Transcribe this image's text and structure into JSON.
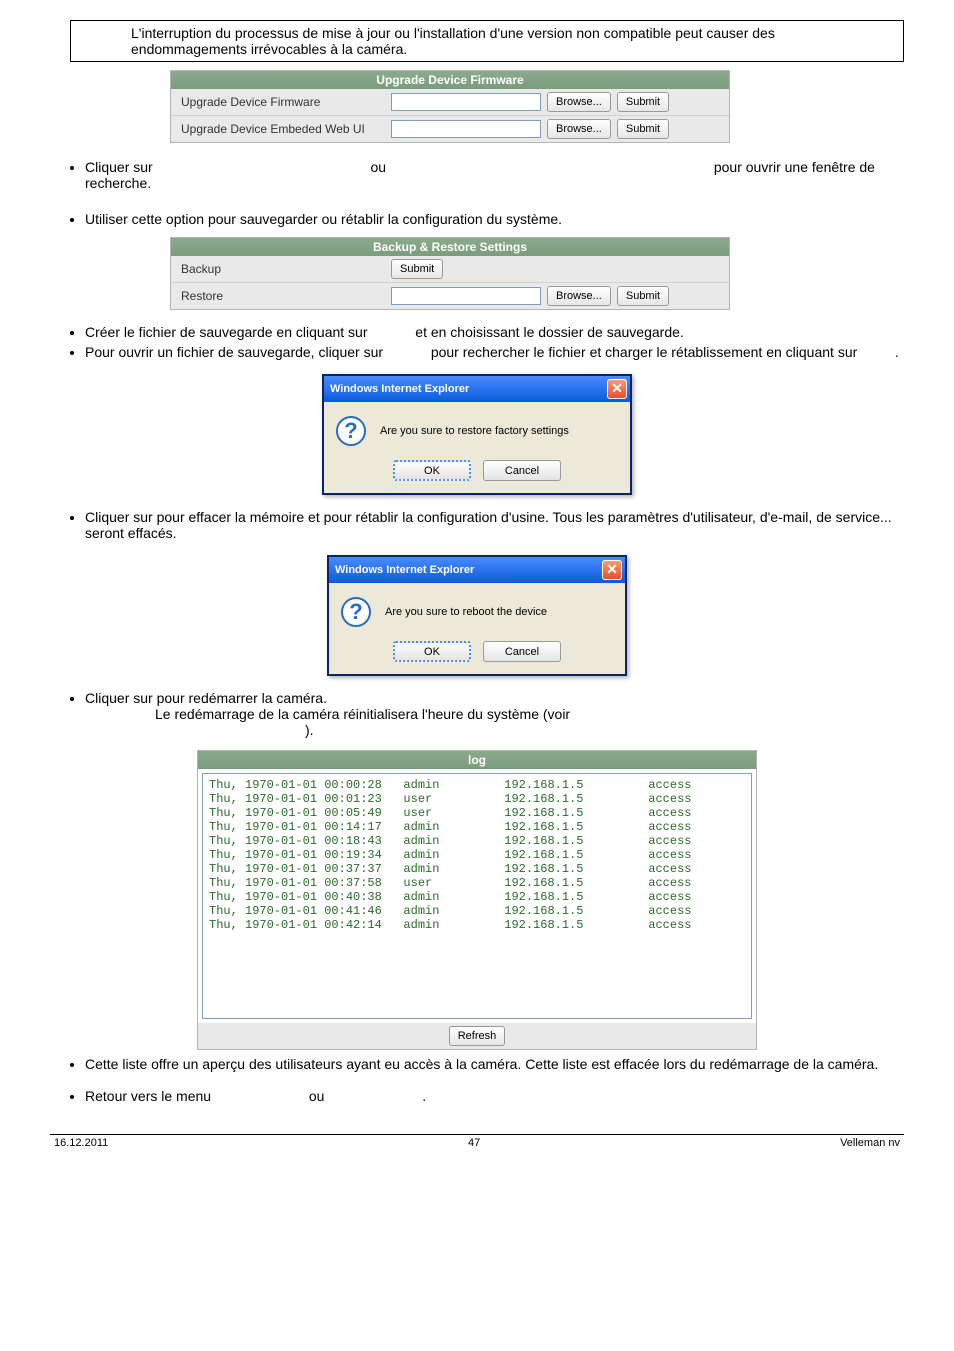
{
  "warning": "L'interruption du processus de mise à jour ou l'installation d'une version non compatible peut causer des endommagements irrévocables à la caméra.",
  "upgrade_panel": {
    "title": "Upgrade Device Firmware",
    "rows": [
      {
        "label": "Upgrade Device Firmware",
        "browse": "Browse...",
        "submit": "Submit"
      },
      {
        "label": "Upgrade Device Embeded Web UI",
        "browse": "Browse...",
        "submit": "Submit"
      }
    ]
  },
  "bullet_browse": {
    "pre": "Cliquer sur",
    "mid": "ou",
    "post": "pour ouvrir une fenêtre de recherche."
  },
  "bullet_backup_intro": "Utiliser cette option pour sauvegarder ou rétablir la configuration du système.",
  "backup_panel": {
    "title": "Backup & Restore Settings",
    "backup_label": "Backup",
    "backup_btn": "Submit",
    "restore_label": "Restore",
    "restore_browse": "Browse...",
    "restore_submit": "Submit"
  },
  "bullet_backup_create": {
    "pre": "Créer le fichier de sauvegarde en cliquant sur",
    "post": "et en choisissant le dossier de sauvegarde."
  },
  "bullet_backup_open": {
    "pre": "Pour ouvrir un fichier de sauvegarde, cliquer sur",
    "mid": "pour rechercher le fichier et charger le rétablissement en cliquant sur",
    "post": "."
  },
  "dialog_restore": {
    "title": "Windows Internet Explorer",
    "msg": "Are you sure to restore factory settings",
    "ok": "OK",
    "cancel": "Cancel"
  },
  "bullet_restore": "Cliquer sur       pour effacer la mémoire et pour rétablir la configuration d'usine. Tous les paramètres d'utilisateur, d'e-mail, de service... seront effacés.",
  "dialog_reboot": {
    "title": "Windows Internet Explorer",
    "msg": "Are you sure to reboot the device",
    "ok": "OK",
    "cancel": "Cancel"
  },
  "bullet_reboot1": "Cliquer sur       pour redémarrer la caméra.",
  "bullet_reboot2": "Le redémarrage de la caméra réinitialisera l'heure du système (voir",
  "bullet_reboot3": ").",
  "log": {
    "title": "log",
    "refresh": "Refresh",
    "entries": [
      {
        "ts": "Thu, 1970-01-01 00:00:28",
        "user": "admin",
        "ip": "192.168.1.5",
        "act": "access"
      },
      {
        "ts": "Thu, 1970-01-01 00:01:23",
        "user": "user",
        "ip": "192.168.1.5",
        "act": "access"
      },
      {
        "ts": "Thu, 1970-01-01 00:05:49",
        "user": "user",
        "ip": "192.168.1.5",
        "act": "access"
      },
      {
        "ts": "Thu, 1970-01-01 00:14:17",
        "user": "admin",
        "ip": "192.168.1.5",
        "act": "access"
      },
      {
        "ts": "Thu, 1970-01-01 00:18:43",
        "user": "admin",
        "ip": "192.168.1.5",
        "act": "access"
      },
      {
        "ts": "Thu, 1970-01-01 00:19:34",
        "user": "admin",
        "ip": "192.168.1.5",
        "act": "access"
      },
      {
        "ts": "Thu, 1970-01-01 00:37:37",
        "user": "admin",
        "ip": "192.168.1.5",
        "act": "access"
      },
      {
        "ts": "Thu, 1970-01-01 00:37:58",
        "user": "user",
        "ip": "192.168.1.5",
        "act": "access"
      },
      {
        "ts": "Thu, 1970-01-01 00:40:38",
        "user": "admin",
        "ip": "192.168.1.5",
        "act": "access"
      },
      {
        "ts": "Thu, 1970-01-01 00:41:46",
        "user": "admin",
        "ip": "192.168.1.5",
        "act": "access"
      },
      {
        "ts": "Thu, 1970-01-01 00:42:14",
        "user": "admin",
        "ip": "192.168.1.5",
        "act": "access"
      }
    ]
  },
  "bullet_log": "Cette liste offre un aperçu des utilisateurs ayant eu accès à la caméra. Cette liste est effacée lors du redémarrage de la caméra.",
  "bullet_return": {
    "pre": "Retour vers le menu",
    "mid": "ou",
    "post": "."
  },
  "footer": {
    "date": "16.12.2011",
    "page": "47",
    "company": "Velleman nv"
  }
}
